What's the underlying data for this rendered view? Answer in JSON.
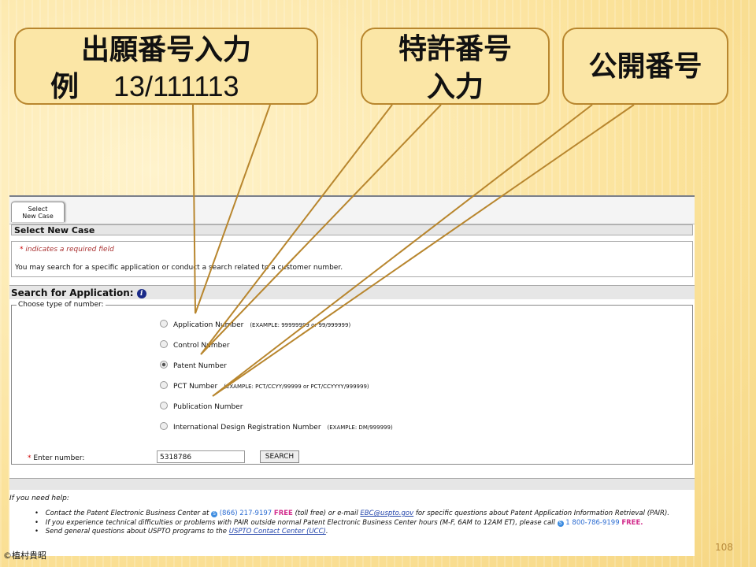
{
  "callouts": {
    "application": {
      "line1": "出願番号入力",
      "line2_prefix": "例",
      "line2_number": "13/111113"
    },
    "patent": {
      "line1": "特許番号",
      "line2": "入力"
    },
    "publication": {
      "line1": "公開番号"
    }
  },
  "app": {
    "tab_label_line1": "Select",
    "tab_label_line2": "New Case",
    "section_title": "Select New Case",
    "required_note": "indicates a required field",
    "required_star": "*",
    "intro_text": "You may search for a specific application or conduct a search related to a customer number.",
    "search_title": "Search for Application:",
    "info_icon_glyph": "i",
    "fieldset_legend": "Choose type of number:",
    "options": [
      {
        "label": "Application Number",
        "example": "(EXAMPLE: 99999999 or 99/999999)",
        "selected": false
      },
      {
        "label": "Control Number",
        "example": "",
        "selected": false
      },
      {
        "label": "Patent Number",
        "example": "",
        "selected": true
      },
      {
        "label": "PCT Number",
        "example": "(EXAMPLE: PCT/CCYY/99999 or PCT/CCYYYY/999999)",
        "selected": false
      },
      {
        "label": "Publication Number",
        "example": "",
        "selected": false
      },
      {
        "label": "International Design Registration Number",
        "example": "(EXAMPLE: DM/999999)",
        "selected": false
      }
    ],
    "enter_label": "Enter number:",
    "enter_star": "*",
    "number_value": "5318786",
    "search_button": "SEARCH",
    "help": {
      "title": "If you need help:",
      "line1": {
        "before": "Contact the Patent Electronic Business Center at",
        "phone": "(866) 217-9197",
        "free": "FREE",
        "mid": "(toll free) or e-mail",
        "email": "EBC@uspto.gov",
        "after": "for specific questions about Patent Application Information Retrieval (PAIR)."
      },
      "line2": {
        "before": "If you experience technical difficulties or problems with PAIR outside normal Patent Electronic Business Center hours (M-F, 6AM to 12AM ET), please call",
        "phone": "1 800-786-9199",
        "free": "FREE."
      },
      "line3": {
        "before": "Send general questions about USPTO programs to the",
        "link": "USPTO Contact Center (UCC)",
        "after": "."
      },
      "skype_glyph": "S"
    }
  },
  "footer": {
    "copyright": "©植村貴昭",
    "page_number": "108"
  },
  "colors": {
    "callout_border": "#b8862e",
    "slide_bg": "#fbe7a8",
    "free": "#d22c8c",
    "link": "#2244aa"
  }
}
